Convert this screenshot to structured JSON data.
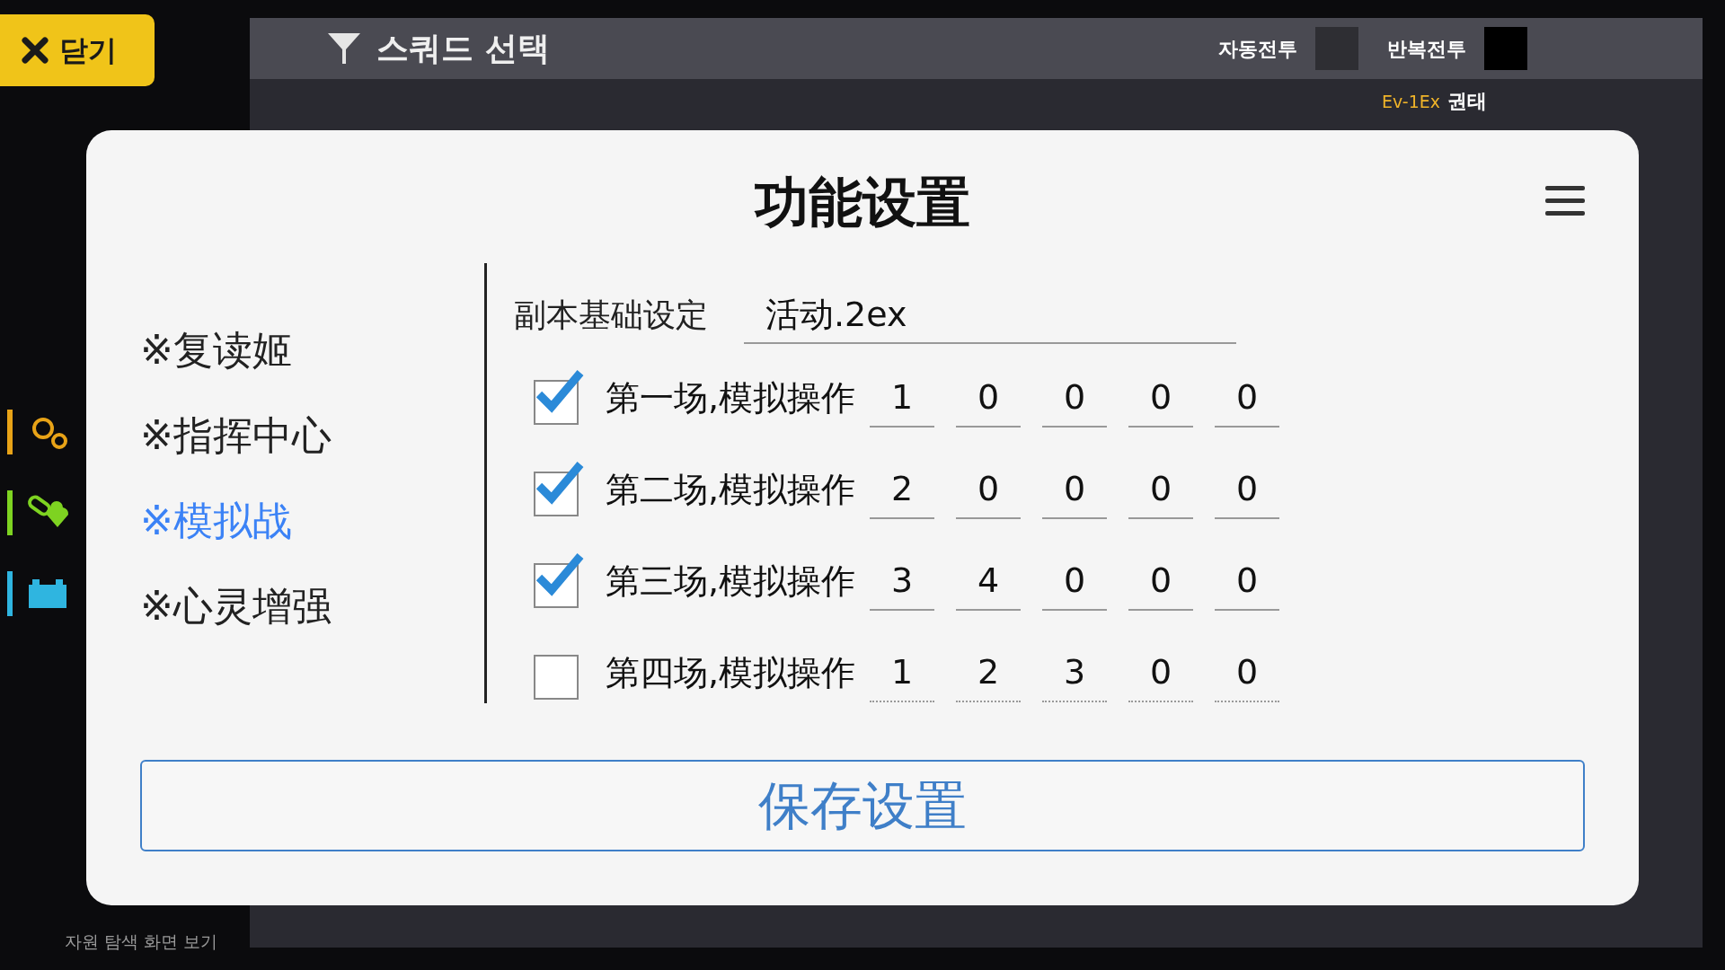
{
  "close_button": {
    "label": "닫기"
  },
  "header": {
    "title": "스쿼드 선택",
    "toggles": [
      {
        "label": "자동전투",
        "on": false
      },
      {
        "label": "반복전투",
        "on": true
      }
    ]
  },
  "stage": {
    "code": "Ev-1Ex",
    "name": "권태"
  },
  "resources": [
    {
      "kind": "parts",
      "color": "#e8a317"
    },
    {
      "kind": "ration",
      "color": "#7ed321"
    },
    {
      "kind": "power",
      "color": "#2fb5e0"
    }
  ],
  "footer_link": "자원 탐색 화면 보기",
  "dialog": {
    "title": "功能设置",
    "menu": [
      {
        "label": "※复读姬",
        "selected": false
      },
      {
        "label": "※指挥中心",
        "selected": false
      },
      {
        "label": "※模拟战",
        "selected": true
      },
      {
        "label": "※心灵增强",
        "selected": false
      }
    ],
    "base_setting": {
      "label": "副本基础设定",
      "value": "活动.2ex"
    },
    "rows": [
      {
        "label": "第一场,模拟操作",
        "checked": true,
        "digits": [
          "1",
          "0",
          "0",
          "0",
          "0"
        ]
      },
      {
        "label": "第二场,模拟操作",
        "checked": true,
        "digits": [
          "2",
          "0",
          "0",
          "0",
          "0"
        ]
      },
      {
        "label": "第三场,模拟操作",
        "checked": true,
        "digits": [
          "3",
          "4",
          "0",
          "0",
          "0"
        ]
      },
      {
        "label": "第四场,模拟操作",
        "checked": false,
        "digits": [
          "1",
          "2",
          "3",
          "0",
          "0"
        ]
      }
    ],
    "save_button": "保存设置"
  }
}
